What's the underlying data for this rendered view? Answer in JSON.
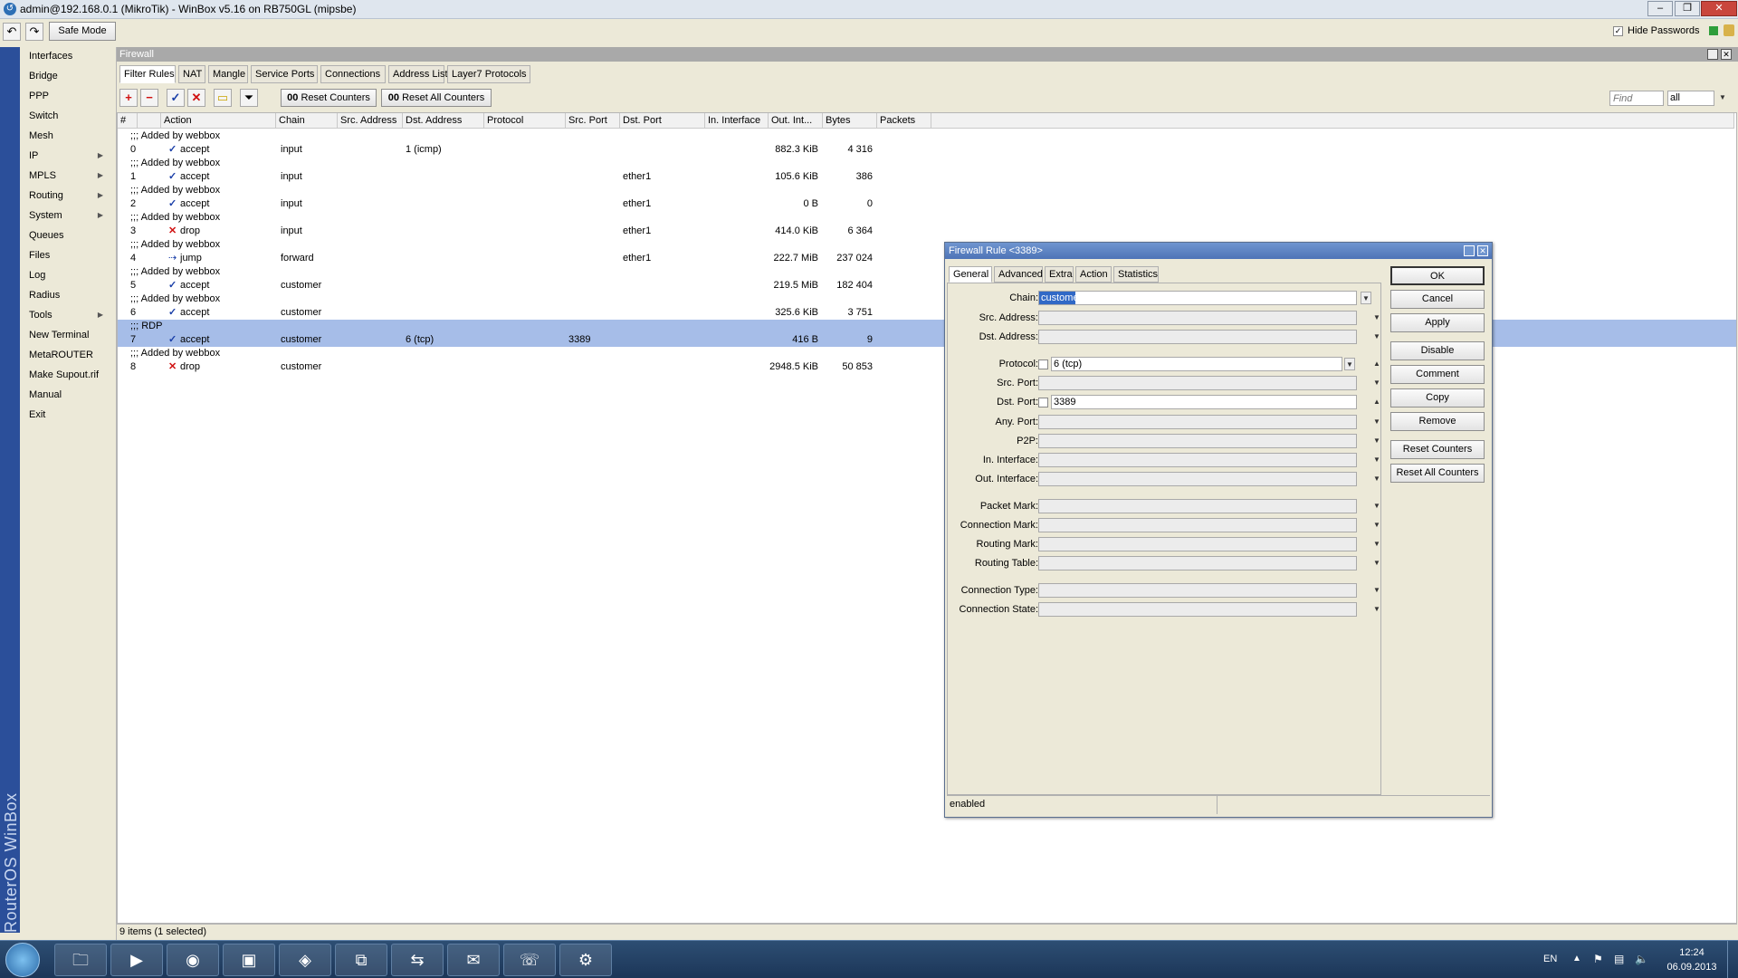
{
  "window": {
    "title": "admin@192.168.0.1 (MikroTik) - WinBox v5.16 on RB750GL (mipsbe)"
  },
  "toolbar": {
    "safe_mode": "Safe Mode",
    "hide_passwords": "Hide Passwords"
  },
  "sidebar": {
    "vertical_label": "RouterOS WinBox",
    "items": [
      {
        "label": "Interfaces",
        "submenu": false
      },
      {
        "label": "Bridge",
        "submenu": false
      },
      {
        "label": "PPP",
        "submenu": false
      },
      {
        "label": "Switch",
        "submenu": false
      },
      {
        "label": "Mesh",
        "submenu": false
      },
      {
        "label": "IP",
        "submenu": true
      },
      {
        "label": "MPLS",
        "submenu": true
      },
      {
        "label": "Routing",
        "submenu": true
      },
      {
        "label": "System",
        "submenu": true
      },
      {
        "label": "Queues",
        "submenu": false
      },
      {
        "label": "Files",
        "submenu": false
      },
      {
        "label": "Log",
        "submenu": false
      },
      {
        "label": "Radius",
        "submenu": false
      },
      {
        "label": "Tools",
        "submenu": true
      },
      {
        "label": "New Terminal",
        "submenu": false
      },
      {
        "label": "MetaROUTER",
        "submenu": false
      },
      {
        "label": "Make Supout.rif",
        "submenu": false
      },
      {
        "label": "Manual",
        "submenu": false
      },
      {
        "label": "Exit",
        "submenu": false
      }
    ]
  },
  "firewall": {
    "title": "Firewall",
    "tabs": [
      "Filter Rules",
      "NAT",
      "Mangle",
      "Service Ports",
      "Connections",
      "Address Lists",
      "Layer7 Protocols"
    ],
    "reset_counters": "Reset Counters",
    "reset_all_counters": "Reset All Counters",
    "find_placeholder": "Find",
    "filter_value": "all",
    "columns": [
      "#",
      "Action",
      "Chain",
      "Src. Address",
      "Dst. Address",
      "Protocol",
      "Src. Port",
      "Dst. Port",
      "In. Interface",
      "Out. Int...",
      "Bytes",
      "Packets"
    ],
    "rows": [
      {
        "comment": ";;; Added by webbox",
        "num": "0",
        "action": "accept",
        "chain": "input",
        "protocol": "1 (icmp)",
        "dst_port": "",
        "in_iface": "",
        "bytes": "882.3 KiB",
        "packets": "4 316",
        "selected": false
      },
      {
        "comment": ";;; Added by webbox",
        "num": "1",
        "action": "accept",
        "chain": "input",
        "protocol": "",
        "dst_port": "",
        "in_iface": "ether1",
        "bytes": "105.6 KiB",
        "packets": "386",
        "selected": false
      },
      {
        "comment": ";;; Added by webbox",
        "num": "2",
        "action": "accept",
        "chain": "input",
        "protocol": "",
        "dst_port": "",
        "in_iface": "ether1",
        "bytes": "0 B",
        "packets": "0",
        "selected": false
      },
      {
        "comment": ";;; Added by webbox",
        "num": "3",
        "action": "drop",
        "chain": "input",
        "protocol": "",
        "dst_port": "",
        "in_iface": "ether1",
        "bytes": "414.0 KiB",
        "packets": "6 364",
        "selected": false
      },
      {
        "comment": ";;; Added by webbox",
        "num": "4",
        "action": "jump",
        "chain": "forward",
        "protocol": "",
        "dst_port": "",
        "in_iface": "ether1",
        "bytes": "222.7 MiB",
        "packets": "237 024",
        "selected": false
      },
      {
        "comment": ";;; Added by webbox",
        "num": "5",
        "action": "accept",
        "chain": "customer",
        "protocol": "",
        "dst_port": "",
        "in_iface": "",
        "bytes": "219.5 MiB",
        "packets": "182 404",
        "selected": false
      },
      {
        "comment": ";;; Added by webbox",
        "num": "6",
        "action": "accept",
        "chain": "customer",
        "protocol": "",
        "dst_port": "",
        "in_iface": "",
        "bytes": "325.6 KiB",
        "packets": "3 751",
        "selected": false
      },
      {
        "comment": ";;; RDP",
        "num": "7",
        "action": "accept",
        "chain": "customer",
        "protocol": "6 (tcp)",
        "dst_port": "3389",
        "in_iface": "",
        "bytes": "416 B",
        "packets": "9",
        "selected": true
      },
      {
        "comment": ";;; Added by webbox",
        "num": "8",
        "action": "drop",
        "chain": "customer",
        "protocol": "",
        "dst_port": "",
        "in_iface": "",
        "bytes": "2948.5 KiB",
        "packets": "50 853",
        "selected": false
      }
    ],
    "status": "9 items (1 selected)"
  },
  "dialog": {
    "title": "Firewall Rule <3389>",
    "tabs": [
      "General",
      "Advanced",
      "Extra",
      "Action",
      "Statistics"
    ],
    "fields": [
      {
        "label": "Chain:",
        "value": "customer",
        "checkbox": false
      },
      {
        "label": "Src. Address:",
        "value": "",
        "checkbox": false
      },
      {
        "label": "Dst. Address:",
        "value": "",
        "checkbox": false
      },
      {
        "label": "Protocol:",
        "value": "6 (tcp)",
        "checkbox": true
      },
      {
        "label": "Src. Port:",
        "value": "",
        "checkbox": false
      },
      {
        "label": "Dst. Port:",
        "value": "3389",
        "checkbox": true
      },
      {
        "label": "Any. Port:",
        "value": "",
        "checkbox": false
      },
      {
        "label": "P2P:",
        "value": "",
        "checkbox": false
      },
      {
        "label": "In. Interface:",
        "value": "",
        "checkbox": false
      },
      {
        "label": "Out. Interface:",
        "value": "",
        "checkbox": false
      },
      {
        "label": "Packet Mark:",
        "value": "",
        "checkbox": false
      },
      {
        "label": "Connection Mark:",
        "value": "",
        "checkbox": false
      },
      {
        "label": "Routing Mark:",
        "value": "",
        "checkbox": false
      },
      {
        "label": "Routing Table:",
        "value": "",
        "checkbox": false
      },
      {
        "label": "Connection Type:",
        "value": "",
        "checkbox": false
      },
      {
        "label": "Connection State:",
        "value": "",
        "checkbox": false
      }
    ],
    "buttons": [
      "OK",
      "Cancel",
      "Apply",
      "Disable",
      "Comment",
      "Copy",
      "Remove",
      "Reset Counters",
      "Reset All Counters"
    ],
    "status": "enabled"
  },
  "taskbar": {
    "lang": "EN",
    "time": "12:24",
    "date": "06.09.2013"
  }
}
